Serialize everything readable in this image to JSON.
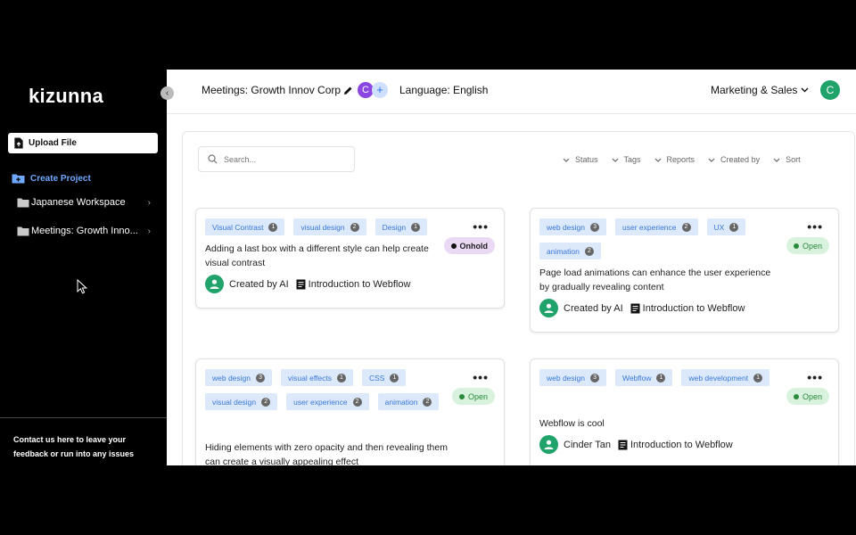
{
  "sidebar": {
    "logo": "kizunna",
    "collapse_icon": "‹",
    "upload_label": "Upload File",
    "create_project_label": "Create Project",
    "folders": [
      {
        "label": "Japanese Workspace"
      },
      {
        "label": "Meetings: Growth Inno..."
      }
    ],
    "feedback_text": "Contact us here to leave your feedback or run into any issues"
  },
  "topbar": {
    "meeting_title": "Meetings: Growth Innov Corp",
    "avatar_initial": "C",
    "add_label": "+",
    "language": "Language: English",
    "workspace": "Marketing & Sales",
    "user_initial": "C"
  },
  "toolbar": {
    "search_placeholder": "Search...",
    "filters": [
      "Status",
      "Tags",
      "Reports",
      "Created by",
      "Sort"
    ]
  },
  "colors": {
    "accent_blue": "#3a78d6",
    "tag_bg": "#dce9fb",
    "open_green": "#2a8a3c",
    "onhold_purple": "#ead9f4",
    "avatar_green": "#1fa36b"
  },
  "cards": [
    {
      "tags": [
        {
          "label": "Visual Contrast",
          "count": "1"
        },
        {
          "label": "visual design",
          "count": "2"
        },
        {
          "label": "Design",
          "count": "1"
        }
      ],
      "status": "Onhold",
      "text": "Adding a last box with a different style can help create visual contrast",
      "author": "Created by AI",
      "report": "Introduction to Webflow"
    },
    {
      "tags": [
        {
          "label": "web design",
          "count": "3"
        },
        {
          "label": "user experience",
          "count": "2"
        },
        {
          "label": "UX",
          "count": "1"
        },
        {
          "label": "animation",
          "count": "2"
        }
      ],
      "status": "Open",
      "text": "Page load animations can enhance the user experience by gradually revealing content",
      "author": "Created by AI",
      "report": "Introduction to Webflow"
    },
    {
      "tags": [
        {
          "label": "web design",
          "count": "3"
        },
        {
          "label": "visual effects",
          "count": "1"
        },
        {
          "label": "CSS",
          "count": "1"
        },
        {
          "label": "visual design",
          "count": "2"
        },
        {
          "label": "user experience",
          "count": "2"
        },
        {
          "label": "animation",
          "count": "2"
        }
      ],
      "status": "Open",
      "text": "Hiding elements with zero opacity and then revealing them can create a visually appealing effect"
    },
    {
      "tags": [
        {
          "label": "web design",
          "count": "3"
        },
        {
          "label": "Webflow",
          "count": "1"
        },
        {
          "label": "web development",
          "count": "1"
        }
      ],
      "status": "Open",
      "text": "Webflow is cool",
      "author": "Cinder Tan",
      "report": "Introduction to Webflow"
    }
  ]
}
